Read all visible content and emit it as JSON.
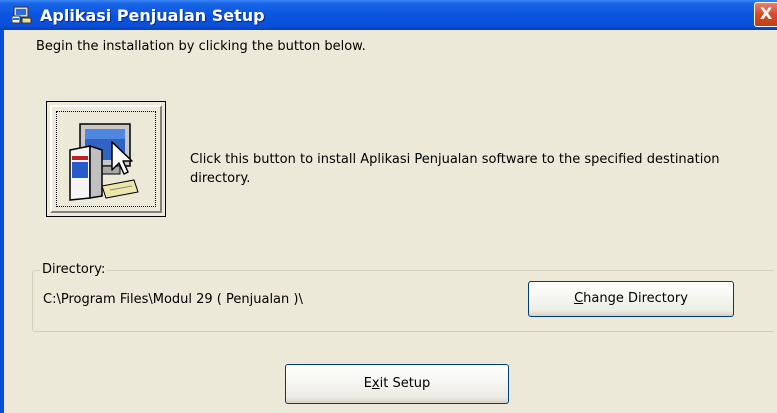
{
  "window": {
    "title": "Aplikasi Penjualan Setup",
    "close_glyph": "X"
  },
  "intro_text": "Begin the installation by clicking the button below.",
  "install": {
    "icon": "setup-computer-icon",
    "description": "Click this button to install Aplikasi Penjualan software to the specified destination directory."
  },
  "directory": {
    "group_label": "Directory:",
    "path": "C:\\Program Files\\Modul 29 ( Penjualan )\\"
  },
  "buttons": {
    "change_directory": {
      "mnemonic": "C",
      "rest": "hange Directory"
    },
    "exit_setup": {
      "before": "E",
      "mnemonic": "x",
      "rest": "it Setup"
    }
  },
  "colors": {
    "titlebar": "#0a4fd8",
    "client_bg": "#ece9d8",
    "close_button": "#d84e2d"
  }
}
